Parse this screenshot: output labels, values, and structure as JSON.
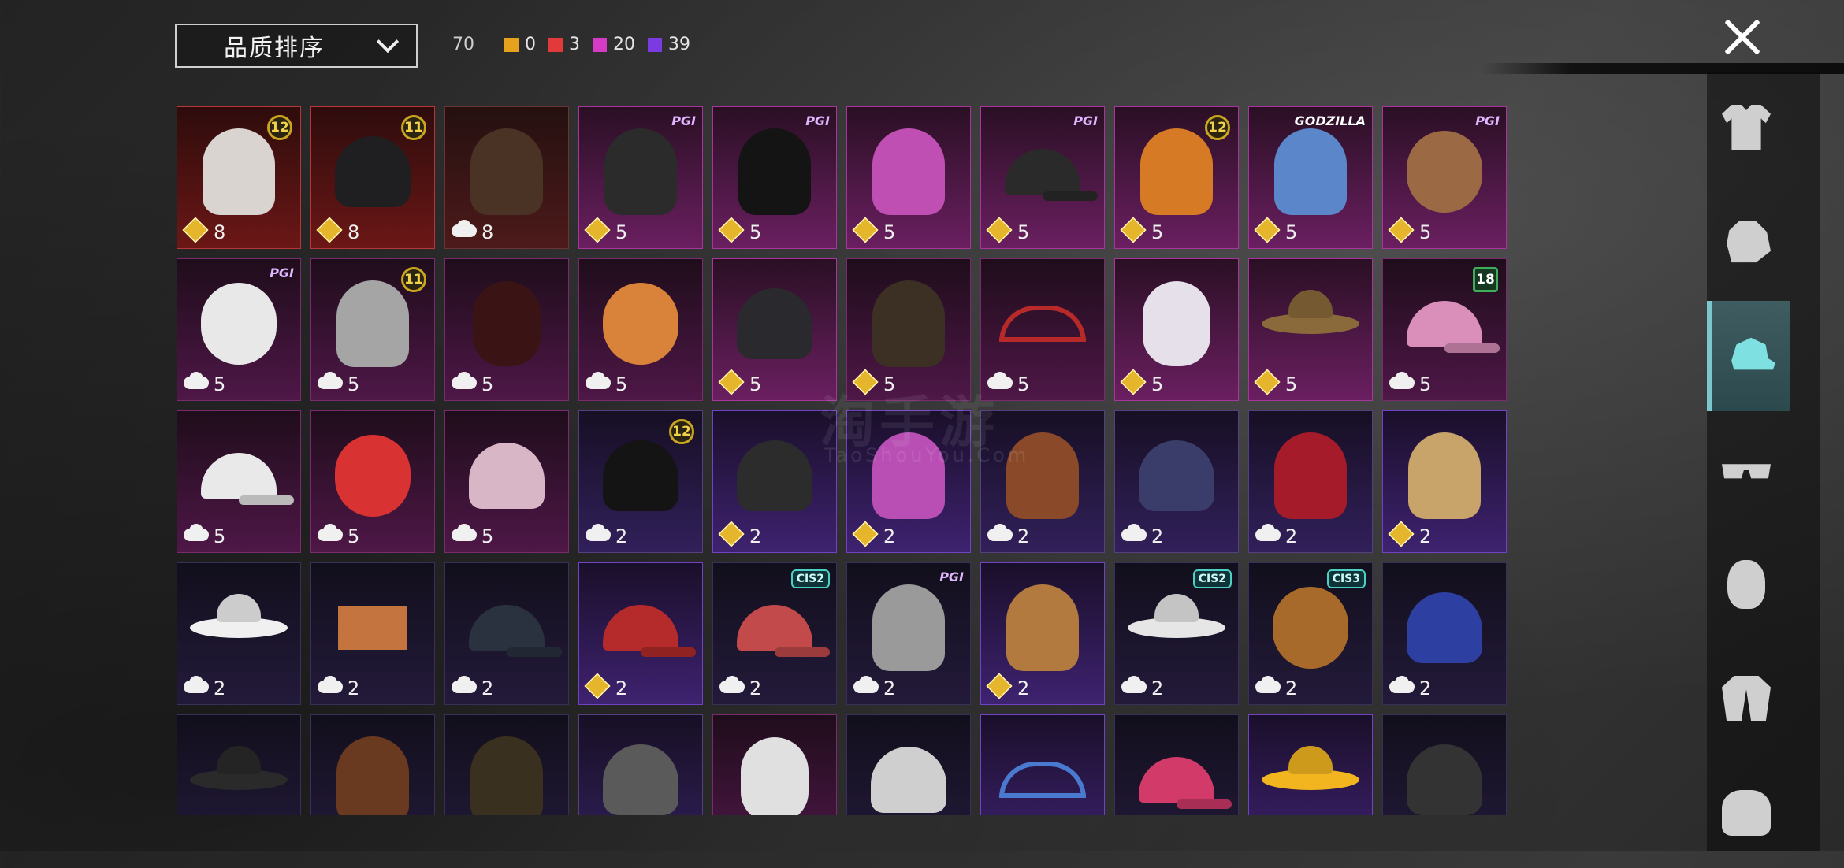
{
  "sort": {
    "label": "品质排序"
  },
  "total_count": "70",
  "rarity_counts": [
    {
      "name": "legendary",
      "color": "#e6a21c",
      "value": "0"
    },
    {
      "name": "epic",
      "color": "#e23a3a",
      "value": "3"
    },
    {
      "name": "mythic",
      "color": "#d53bc4",
      "value": "20"
    },
    {
      "name": "rare",
      "color": "#7a3be0",
      "value": "39"
    }
  ],
  "side_tabs": [
    {
      "name": "outfit",
      "icon": "outfit-icon"
    },
    {
      "name": "helmet",
      "icon": "helmet-icon"
    },
    {
      "name": "hat",
      "icon": "cap-icon",
      "active": true
    },
    {
      "name": "glasses",
      "icon": "glasses-icon"
    },
    {
      "name": "face",
      "icon": "face-icon"
    },
    {
      "name": "jacket",
      "icon": "jacket-icon"
    },
    {
      "name": "backpack",
      "icon": "backpack-icon"
    }
  ],
  "watermark": {
    "text": "淘手游",
    "sub": "TaoShouYou.Com"
  },
  "items": [
    {
      "q": "gold",
      "art": "hair",
      "color": "#d9d4d0",
      "cur": "diamond",
      "count": "8",
      "badge": "12"
    },
    {
      "q": "gold",
      "art": "helmet",
      "color": "#1f1f22",
      "cur": "diamond",
      "count": "8",
      "badge": "11"
    },
    {
      "q": "red",
      "art": "hair",
      "color": "#4a3324",
      "cur": "cloud",
      "count": "8"
    },
    {
      "q": "pink",
      "art": "hair",
      "color": "#2b2b2b",
      "cur": "diamond",
      "count": "5",
      "brand": "PGI"
    },
    {
      "q": "pink",
      "art": "hair",
      "color": "#141414",
      "cur": "diamond",
      "count": "5",
      "brand": "PGI"
    },
    {
      "q": "pink",
      "art": "hair",
      "color": "#c04fb4",
      "cur": "diamond",
      "count": "5"
    },
    {
      "q": "pink",
      "art": "cap",
      "color": "#2a2a2a",
      "cur": "diamond",
      "count": "5",
      "brand": "PGI"
    },
    {
      "q": "pink",
      "art": "hair",
      "color": "#d67a26",
      "cur": "diamond",
      "count": "5",
      "badge": "12"
    },
    {
      "q": "pink",
      "art": "hair",
      "color": "#5b86c9",
      "cur": "diamond",
      "count": "5",
      "brand": "GODZILLA"
    },
    {
      "q": "pink",
      "art": "head",
      "color": "#9b6a45",
      "cur": "diamond",
      "count": "5",
      "brand": "PGI"
    },
    {
      "q": "pinkdark",
      "art": "head",
      "color": "#e8e8e8",
      "cur": "cloud",
      "count": "5",
      "brand": "PGI"
    },
    {
      "q": "pinkdark",
      "art": "hair",
      "color": "#a5a5a5",
      "cur": "cloud",
      "count": "5",
      "badge": "11"
    },
    {
      "q": "pinkdark",
      "art": "mask",
      "color": "#3a1414",
      "cur": "cloud",
      "count": "5"
    },
    {
      "q": "pinkdark",
      "art": "head",
      "color": "#d9833a",
      "cur": "cloud",
      "count": "5"
    },
    {
      "q": "pink",
      "art": "helmet",
      "color": "#2a2a2e",
      "cur": "diamond",
      "count": "5"
    },
    {
      "q": "pinkdark",
      "art": "hair",
      "color": "#3c3024",
      "cur": "diamond",
      "count": "5"
    },
    {
      "q": "pinkdark",
      "art": "band",
      "color": "#b82a2a",
      "cur": "cloud",
      "count": "5"
    },
    {
      "q": "pink",
      "art": "mask",
      "color": "#e5e0ea",
      "cur": "diamond",
      "count": "5"
    },
    {
      "q": "pink",
      "art": "hat",
      "color": "#8a6a3a",
      "cur": "diamond",
      "count": "5"
    },
    {
      "q": "pinkdark",
      "art": "cap",
      "color": "#d98fb9",
      "cur": "cloud",
      "count": "5",
      "badge": "18",
      "badgeType": "green"
    },
    {
      "q": "pinkdark",
      "art": "cap",
      "color": "#e9e9e9",
      "cur": "cloud",
      "count": "5"
    },
    {
      "q": "pinkdark",
      "art": "head",
      "color": "#d93232",
      "cur": "cloud",
      "count": "5"
    },
    {
      "q": "pinkdark",
      "art": "hood",
      "color": "#d9b6c6",
      "cur": "cloud",
      "count": "5"
    },
    {
      "q": "purple",
      "art": "helmet",
      "color": "#141414",
      "cur": "cloud",
      "count": "2",
      "badge": "12"
    },
    {
      "q": "violet",
      "art": "helmet",
      "color": "#2c2c2c",
      "cur": "diamond",
      "count": "2"
    },
    {
      "q": "violet",
      "art": "hair",
      "color": "#b94fb5",
      "cur": "diamond",
      "count": "2"
    },
    {
      "q": "purple",
      "art": "hair",
      "color": "#8a4a2a",
      "cur": "cloud",
      "count": "2"
    },
    {
      "q": "purple",
      "art": "helmet",
      "color": "#3a3d6a",
      "cur": "cloud",
      "count": "2"
    },
    {
      "q": "purple",
      "art": "hair",
      "color": "#a51b2a",
      "cur": "cloud",
      "count": "2"
    },
    {
      "q": "violet",
      "art": "hair",
      "color": "#c8a46a",
      "cur": "diamond",
      "count": "2"
    },
    {
      "q": "navy",
      "art": "hat",
      "color": "#f0f0f0",
      "cur": "cloud",
      "count": "2"
    },
    {
      "q": "navy",
      "art": "ears",
      "color": "#c4743f",
      "cur": "cloud",
      "count": "2"
    },
    {
      "q": "navy",
      "art": "cap",
      "color": "#2a3240",
      "cur": "cloud",
      "count": "2"
    },
    {
      "q": "violet",
      "art": "cap",
      "color": "#b52a2a",
      "cur": "diamond",
      "count": "2"
    },
    {
      "q": "navy",
      "art": "cap",
      "color": "#c24a4a",
      "cur": "cloud",
      "count": "2",
      "brand": "CIS2",
      "brandType": "cis"
    },
    {
      "q": "navy",
      "art": "hair",
      "color": "#9a9a9a",
      "cur": "cloud",
      "count": "2",
      "brand": "PGI"
    },
    {
      "q": "violet",
      "art": "hair",
      "color": "#b27a3e",
      "cur": "diamond",
      "count": "2"
    },
    {
      "q": "navy",
      "art": "hat",
      "color": "#e6e6e6",
      "cur": "cloud",
      "count": "2",
      "brand": "CIS2",
      "brandType": "cis"
    },
    {
      "q": "navy",
      "art": "head",
      "color": "#a86a2a",
      "cur": "cloud",
      "count": "2",
      "brand": "CIS3",
      "brandType": "cis"
    },
    {
      "q": "navy",
      "art": "helmet",
      "color": "#2d3fa0",
      "cur": "cloud",
      "count": "2"
    },
    {
      "q": "navy",
      "art": "hat",
      "color": "#2a2a2a",
      "cur": "cloud",
      "count": ""
    },
    {
      "q": "navy",
      "art": "hair",
      "color": "#6a3a20",
      "cur": "cloud",
      "count": ""
    },
    {
      "q": "navy",
      "art": "hair",
      "color": "#3a3020",
      "cur": "cloud",
      "count": ""
    },
    {
      "q": "purple",
      "art": "helmet",
      "color": "#5a5a5a",
      "cur": "cloud",
      "count": ""
    },
    {
      "q": "pinkdark",
      "art": "mask",
      "color": "#e0e0e0",
      "cur": "cloud",
      "count": ""
    },
    {
      "q": "navy",
      "art": "hood",
      "color": "#cfcfcf",
      "cur": "cloud",
      "count": ""
    },
    {
      "q": "violet",
      "art": "band",
      "color": "#4a7ad0",
      "cur": "cloud",
      "count": ""
    },
    {
      "q": "navy",
      "art": "cap",
      "color": "#d23a6a",
      "cur": "cloud",
      "count": ""
    },
    {
      "q": "violet",
      "art": "hat",
      "color": "#f2b520",
      "cur": "cloud",
      "count": ""
    },
    {
      "q": "navy",
      "art": "helmet",
      "color": "#333333",
      "cur": "cloud",
      "count": ""
    }
  ]
}
